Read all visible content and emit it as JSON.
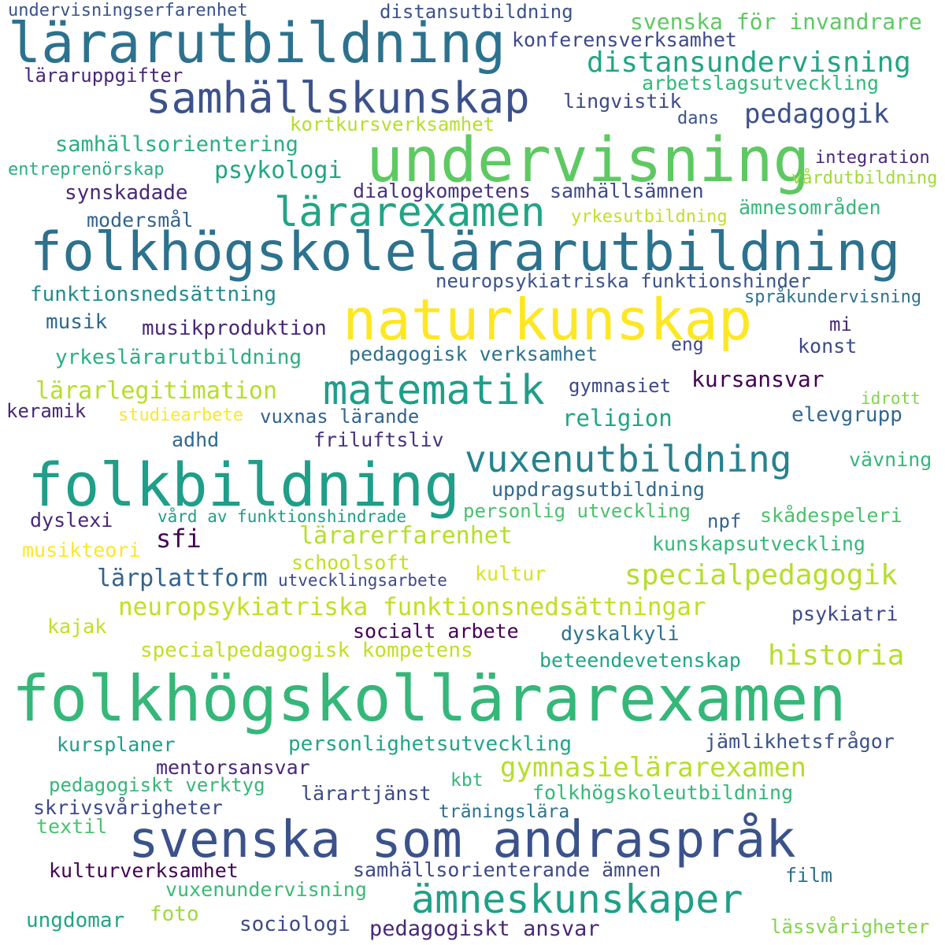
{
  "words": [
    {
      "text": "undervisningserfarenhet",
      "color": "#3b528b"
    },
    {
      "text": "distansutbildning",
      "color": "#3b528b"
    },
    {
      "text": "lärarutbildning",
      "color": "#2c728e"
    },
    {
      "text": "svenska för invandrare",
      "color": "#5ec962"
    },
    {
      "text": "konferensverksamhet",
      "color": "#3e4989"
    },
    {
      "text": "distansundervisning",
      "color": "#21a585"
    },
    {
      "text": "läraruppgifter",
      "color": "#482878"
    },
    {
      "text": "arbetslagsutveckling",
      "color": "#35b779"
    },
    {
      "text": "samhällskunskap",
      "color": "#3b528b"
    },
    {
      "text": "lingvistik",
      "color": "#3e4989"
    },
    {
      "text": "pedagogik",
      "color": "#3b528b"
    },
    {
      "text": "dans",
      "color": "#3b528b"
    },
    {
      "text": "kortkursverksamhet",
      "color": "#b5de2b"
    },
    {
      "text": "undervisning",
      "color": "#5ec962"
    },
    {
      "text": "samhällsorientering",
      "color": "#29af7f"
    },
    {
      "text": "integration",
      "color": "#482878"
    },
    {
      "text": "entreprenörskap",
      "color": "#29af7f"
    },
    {
      "text": "psykologi",
      "color": "#21a585"
    },
    {
      "text": "vårdutbildning",
      "color": "#a0da39"
    },
    {
      "text": "synskadade",
      "color": "#482878"
    },
    {
      "text": "dialogkompetens",
      "color": "#46327e"
    },
    {
      "text": "samhällsämnen",
      "color": "#3e4989"
    },
    {
      "text": "lärarexamen",
      "color": "#21a585"
    },
    {
      "text": "ämnesområden",
      "color": "#35b779"
    },
    {
      "text": "modersmål",
      "color": "#33638d"
    },
    {
      "text": "yrkesutbildning",
      "color": "#c2df23"
    },
    {
      "text": "folkhögskolelärarutbildning",
      "color": "#2c728e"
    },
    {
      "text": "neuropsykiatriska funktionshinder",
      "color": "#3b528b"
    },
    {
      "text": "funktionsnedsättning",
      "color": "#228c8d"
    },
    {
      "text": "språkundervisning",
      "color": "#2c728e"
    },
    {
      "text": "naturkunskap",
      "color": "#fde725"
    },
    {
      "text": "musik",
      "color": "#31688e"
    },
    {
      "text": "musikproduktion",
      "color": "#482878"
    },
    {
      "text": "mi",
      "color": "#482878"
    },
    {
      "text": "eng",
      "color": "#3e4989"
    },
    {
      "text": "konst",
      "color": "#3e4989"
    },
    {
      "text": "yrkeslärarutbildning",
      "color": "#29af7f"
    },
    {
      "text": "pedagogisk verksamhet",
      "color": "#2c728e"
    },
    {
      "text": "lärarlegitimation",
      "color": "#b5de2b"
    },
    {
      "text": "matematik",
      "color": "#1f9e89"
    },
    {
      "text": "gymnasiet",
      "color": "#3e4989"
    },
    {
      "text": "kursansvar",
      "color": "#440154"
    },
    {
      "text": "idrott",
      "color": "#84d44b"
    },
    {
      "text": "keramik",
      "color": "#482878"
    },
    {
      "text": "studiearbete",
      "color": "#fde725"
    },
    {
      "text": "vuxnas lärande",
      "color": "#33638d"
    },
    {
      "text": "religion",
      "color": "#21a585"
    },
    {
      "text": "elevgrupp",
      "color": "#31688e"
    },
    {
      "text": "adhd",
      "color": "#31688e"
    },
    {
      "text": "friluftsliv",
      "color": "#46327e"
    },
    {
      "text": "folkbildning",
      "color": "#1f9e89"
    },
    {
      "text": "vuxenutbildning",
      "color": "#26828e"
    },
    {
      "text": "vävning",
      "color": "#35b779"
    },
    {
      "text": "uppdragsutbildning",
      "color": "#31688e"
    },
    {
      "text": "dyslexi",
      "color": "#482878"
    },
    {
      "text": "vård av funktionshindrade",
      "color": "#1f9e89"
    },
    {
      "text": "personlig utveckling",
      "color": "#4ac16d"
    },
    {
      "text": "npf",
      "color": "#33638d"
    },
    {
      "text": "skådespeleri",
      "color": "#4ac16d"
    },
    {
      "text": "sfi",
      "color": "#440154"
    },
    {
      "text": "lärarerfarenhet",
      "color": "#b5de2b"
    },
    {
      "text": "musikteori",
      "color": "#fde725"
    },
    {
      "text": "kunskapsutveckling",
      "color": "#35b779"
    },
    {
      "text": "schoolsoft",
      "color": "#c2df23"
    },
    {
      "text": "lärplattform",
      "color": "#33638d"
    },
    {
      "text": "utvecklingsarbete",
      "color": "#3e4989"
    },
    {
      "text": "kultur",
      "color": "#dae319"
    },
    {
      "text": "specialpedagogik",
      "color": "#b5de2b"
    },
    {
      "text": "neuropsykiatriska funktionsnedsättningar",
      "color": "#c2df23"
    },
    {
      "text": "psykiatri",
      "color": "#3e4989"
    },
    {
      "text": "kajak",
      "color": "#c2df23"
    },
    {
      "text": "socialt arbete",
      "color": "#440154"
    },
    {
      "text": "dyskalkyli",
      "color": "#2c728e"
    },
    {
      "text": "historia",
      "color": "#b5de2b"
    },
    {
      "text": "specialpedagogisk kompetens",
      "color": "#c2df23"
    },
    {
      "text": "beteendevetenskap",
      "color": "#21a585"
    },
    {
      "text": "folkhögskollärarexamen",
      "color": "#35b779"
    },
    {
      "text": "kursplaner",
      "color": "#1f9e89"
    },
    {
      "text": "personlighetsutveckling",
      "color": "#21a585"
    },
    {
      "text": "jämlikhetsfrågor",
      "color": "#3b528b"
    },
    {
      "text": "mentorsansvar",
      "color": "#482878"
    },
    {
      "text": "gymnasielärarexamen",
      "color": "#b5de2b"
    },
    {
      "text": "pedagogiskt verktyg",
      "color": "#35b779"
    },
    {
      "text": "kbt",
      "color": "#35b779"
    },
    {
      "text": "folkhögskoleutbildning",
      "color": "#35b779"
    },
    {
      "text": "lärartjänst",
      "color": "#3e4989"
    },
    {
      "text": "skrivsvårigheter",
      "color": "#3e4989"
    },
    {
      "text": "träningslära",
      "color": "#2c728e"
    },
    {
      "text": "textil",
      "color": "#4ac16d"
    },
    {
      "text": "svenska som andraspråk",
      "color": "#3b528b"
    },
    {
      "text": "kulturverksamhet",
      "color": "#440154"
    },
    {
      "text": "samhällsorienterande ämnen",
      "color": "#3e4989"
    },
    {
      "text": "ämneskunskaper",
      "color": "#1fa088"
    },
    {
      "text": "film",
      "color": "#2c728e"
    },
    {
      "text": "vuxenundervisning",
      "color": "#3aba76"
    },
    {
      "text": "ungdomar",
      "color": "#21a585"
    },
    {
      "text": "foto",
      "color": "#a0da39"
    },
    {
      "text": "sociologi",
      "color": "#3e4989"
    },
    {
      "text": "pedagogiskt ansvar",
      "color": "#482878"
    },
    {
      "text": "lässvårigheter",
      "color": "#84d44b"
    }
  ]
}
